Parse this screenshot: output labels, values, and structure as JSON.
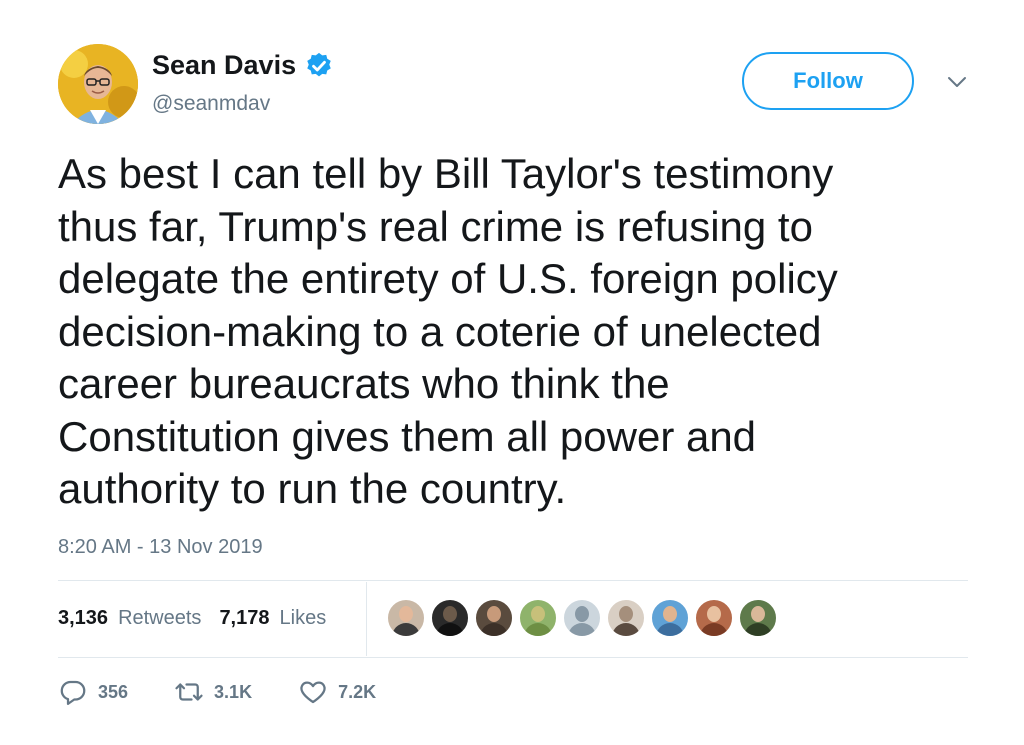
{
  "author": {
    "display_name": "Sean Davis",
    "handle": "@seanmdav",
    "verified": true
  },
  "follow_button": {
    "label": "Follow"
  },
  "tweet": {
    "text": "As best I can tell by Bill Taylor's testimony\nthus far, Trump's real crime is refusing to\ndelegate the entirety of U.S. foreign policy\ndecision-making to a coterie of unelected\ncareer bureaucrats who think the\nConstitution gives them all power and\nauthority to run the country.",
    "timestamp": "8:20 AM - 13 Nov 2019"
  },
  "stats": {
    "retweets_count": "3,136",
    "retweets_label": "Retweets",
    "likes_count": "7,178",
    "likes_label": "Likes"
  },
  "liker_avatars": [
    {
      "bg": "#c9b8a6",
      "skin": "#e3b89a",
      "shirt": "#3b3b3b"
    },
    {
      "bg": "#2a2a2a",
      "skin": "#6b5a4a",
      "shirt": "#111111"
    },
    {
      "bg": "#5a4b3e",
      "skin": "#c79a7a",
      "shirt": "#3c3028"
    },
    {
      "bg": "#8fb36b",
      "skin": "#c7c07a",
      "shirt": "#6e8f44"
    },
    {
      "bg": "#ccd6dd",
      "skin": "#8899a6",
      "shirt": "#8899a6"
    },
    {
      "bg": "#d9cfc4",
      "skin": "#a58f7c",
      "shirt": "#5a4b40"
    },
    {
      "bg": "#5fa2d6",
      "skin": "#e0b48f",
      "shirt": "#3c6e9e"
    },
    {
      "bg": "#b56a4a",
      "skin": "#e8c1a0",
      "shirt": "#7a3b24"
    },
    {
      "bg": "#5e7a4b",
      "skin": "#d9b899",
      "shirt": "#2f3f25"
    }
  ],
  "actions": {
    "reply_count": "356",
    "retweet_count": "3.1K",
    "like_count": "7.2K"
  },
  "colors": {
    "accent": "#1da1f2",
    "secondary_text": "#657786",
    "primary_text": "#14171a",
    "divider": "#e1e8ed"
  },
  "icons": {
    "verified": "verified-badge-icon",
    "caret": "chevron-down-icon",
    "reply": "reply-icon",
    "retweet": "retweet-icon",
    "like": "heart-icon"
  }
}
